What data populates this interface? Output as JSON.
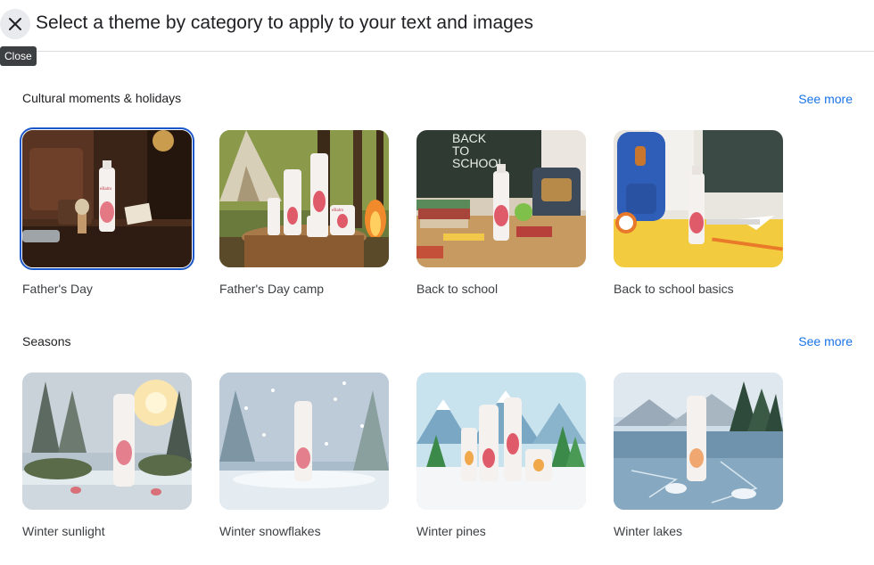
{
  "header": {
    "title": "Select a theme by category to apply to your text and images",
    "close_tooltip": "Close",
    "close_icon": "close-icon"
  },
  "sections": [
    {
      "title": "Cultural moments & holidays",
      "see_more": "See more",
      "themes": [
        {
          "label": "Father's Day",
          "selected": true
        },
        {
          "label": "Father's Day camp",
          "selected": false
        },
        {
          "label": "Back to school",
          "selected": false
        },
        {
          "label": "Back to school basics",
          "selected": false
        }
      ]
    },
    {
      "title": "Seasons",
      "see_more": "See more",
      "themes": [
        {
          "label": "Winter sunlight",
          "selected": false
        },
        {
          "label": "Winter snowflakes",
          "selected": false
        },
        {
          "label": "Winter pines",
          "selected": false
        },
        {
          "label": "Winter lakes",
          "selected": false
        }
      ]
    }
  ],
  "thumbnail_text": {
    "brand": "eBalm",
    "chalkboard": "BACK TO SCHOOL"
  },
  "colors": {
    "accent": "#1a73e8",
    "selected_outline": "#1a57c8",
    "tooltip_bg": "#3c4043"
  }
}
